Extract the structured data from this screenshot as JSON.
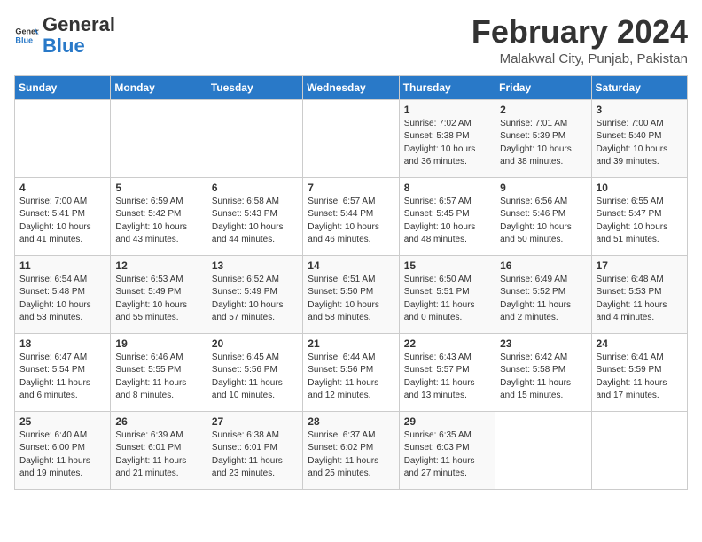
{
  "logo": {
    "general": "General",
    "blue": "Blue"
  },
  "header": {
    "month_year": "February 2024",
    "location": "Malakwal City, Punjab, Pakistan"
  },
  "weekdays": [
    "Sunday",
    "Monday",
    "Tuesday",
    "Wednesday",
    "Thursday",
    "Friday",
    "Saturday"
  ],
  "weeks": [
    [
      {
        "day": "",
        "info": ""
      },
      {
        "day": "",
        "info": ""
      },
      {
        "day": "",
        "info": ""
      },
      {
        "day": "",
        "info": ""
      },
      {
        "day": "1",
        "info": "Sunrise: 7:02 AM\nSunset: 5:38 PM\nDaylight: 10 hours\nand 36 minutes."
      },
      {
        "day": "2",
        "info": "Sunrise: 7:01 AM\nSunset: 5:39 PM\nDaylight: 10 hours\nand 38 minutes."
      },
      {
        "day": "3",
        "info": "Sunrise: 7:00 AM\nSunset: 5:40 PM\nDaylight: 10 hours\nand 39 minutes."
      }
    ],
    [
      {
        "day": "4",
        "info": "Sunrise: 7:00 AM\nSunset: 5:41 PM\nDaylight: 10 hours\nand 41 minutes."
      },
      {
        "day": "5",
        "info": "Sunrise: 6:59 AM\nSunset: 5:42 PM\nDaylight: 10 hours\nand 43 minutes."
      },
      {
        "day": "6",
        "info": "Sunrise: 6:58 AM\nSunset: 5:43 PM\nDaylight: 10 hours\nand 44 minutes."
      },
      {
        "day": "7",
        "info": "Sunrise: 6:57 AM\nSunset: 5:44 PM\nDaylight: 10 hours\nand 46 minutes."
      },
      {
        "day": "8",
        "info": "Sunrise: 6:57 AM\nSunset: 5:45 PM\nDaylight: 10 hours\nand 48 minutes."
      },
      {
        "day": "9",
        "info": "Sunrise: 6:56 AM\nSunset: 5:46 PM\nDaylight: 10 hours\nand 50 minutes."
      },
      {
        "day": "10",
        "info": "Sunrise: 6:55 AM\nSunset: 5:47 PM\nDaylight: 10 hours\nand 51 minutes."
      }
    ],
    [
      {
        "day": "11",
        "info": "Sunrise: 6:54 AM\nSunset: 5:48 PM\nDaylight: 10 hours\nand 53 minutes."
      },
      {
        "day": "12",
        "info": "Sunrise: 6:53 AM\nSunset: 5:49 PM\nDaylight: 10 hours\nand 55 minutes."
      },
      {
        "day": "13",
        "info": "Sunrise: 6:52 AM\nSunset: 5:49 PM\nDaylight: 10 hours\nand 57 minutes."
      },
      {
        "day": "14",
        "info": "Sunrise: 6:51 AM\nSunset: 5:50 PM\nDaylight: 10 hours\nand 58 minutes."
      },
      {
        "day": "15",
        "info": "Sunrise: 6:50 AM\nSunset: 5:51 PM\nDaylight: 11 hours\nand 0 minutes."
      },
      {
        "day": "16",
        "info": "Sunrise: 6:49 AM\nSunset: 5:52 PM\nDaylight: 11 hours\nand 2 minutes."
      },
      {
        "day": "17",
        "info": "Sunrise: 6:48 AM\nSunset: 5:53 PM\nDaylight: 11 hours\nand 4 minutes."
      }
    ],
    [
      {
        "day": "18",
        "info": "Sunrise: 6:47 AM\nSunset: 5:54 PM\nDaylight: 11 hours\nand 6 minutes."
      },
      {
        "day": "19",
        "info": "Sunrise: 6:46 AM\nSunset: 5:55 PM\nDaylight: 11 hours\nand 8 minutes."
      },
      {
        "day": "20",
        "info": "Sunrise: 6:45 AM\nSunset: 5:56 PM\nDaylight: 11 hours\nand 10 minutes."
      },
      {
        "day": "21",
        "info": "Sunrise: 6:44 AM\nSunset: 5:56 PM\nDaylight: 11 hours\nand 12 minutes."
      },
      {
        "day": "22",
        "info": "Sunrise: 6:43 AM\nSunset: 5:57 PM\nDaylight: 11 hours\nand 13 minutes."
      },
      {
        "day": "23",
        "info": "Sunrise: 6:42 AM\nSunset: 5:58 PM\nDaylight: 11 hours\nand 15 minutes."
      },
      {
        "day": "24",
        "info": "Sunrise: 6:41 AM\nSunset: 5:59 PM\nDaylight: 11 hours\nand 17 minutes."
      }
    ],
    [
      {
        "day": "25",
        "info": "Sunrise: 6:40 AM\nSunset: 6:00 PM\nDaylight: 11 hours\nand 19 minutes."
      },
      {
        "day": "26",
        "info": "Sunrise: 6:39 AM\nSunset: 6:01 PM\nDaylight: 11 hours\nand 21 minutes."
      },
      {
        "day": "27",
        "info": "Sunrise: 6:38 AM\nSunset: 6:01 PM\nDaylight: 11 hours\nand 23 minutes."
      },
      {
        "day": "28",
        "info": "Sunrise: 6:37 AM\nSunset: 6:02 PM\nDaylight: 11 hours\nand 25 minutes."
      },
      {
        "day": "29",
        "info": "Sunrise: 6:35 AM\nSunset: 6:03 PM\nDaylight: 11 hours\nand 27 minutes."
      },
      {
        "day": "",
        "info": ""
      },
      {
        "day": "",
        "info": ""
      }
    ]
  ]
}
